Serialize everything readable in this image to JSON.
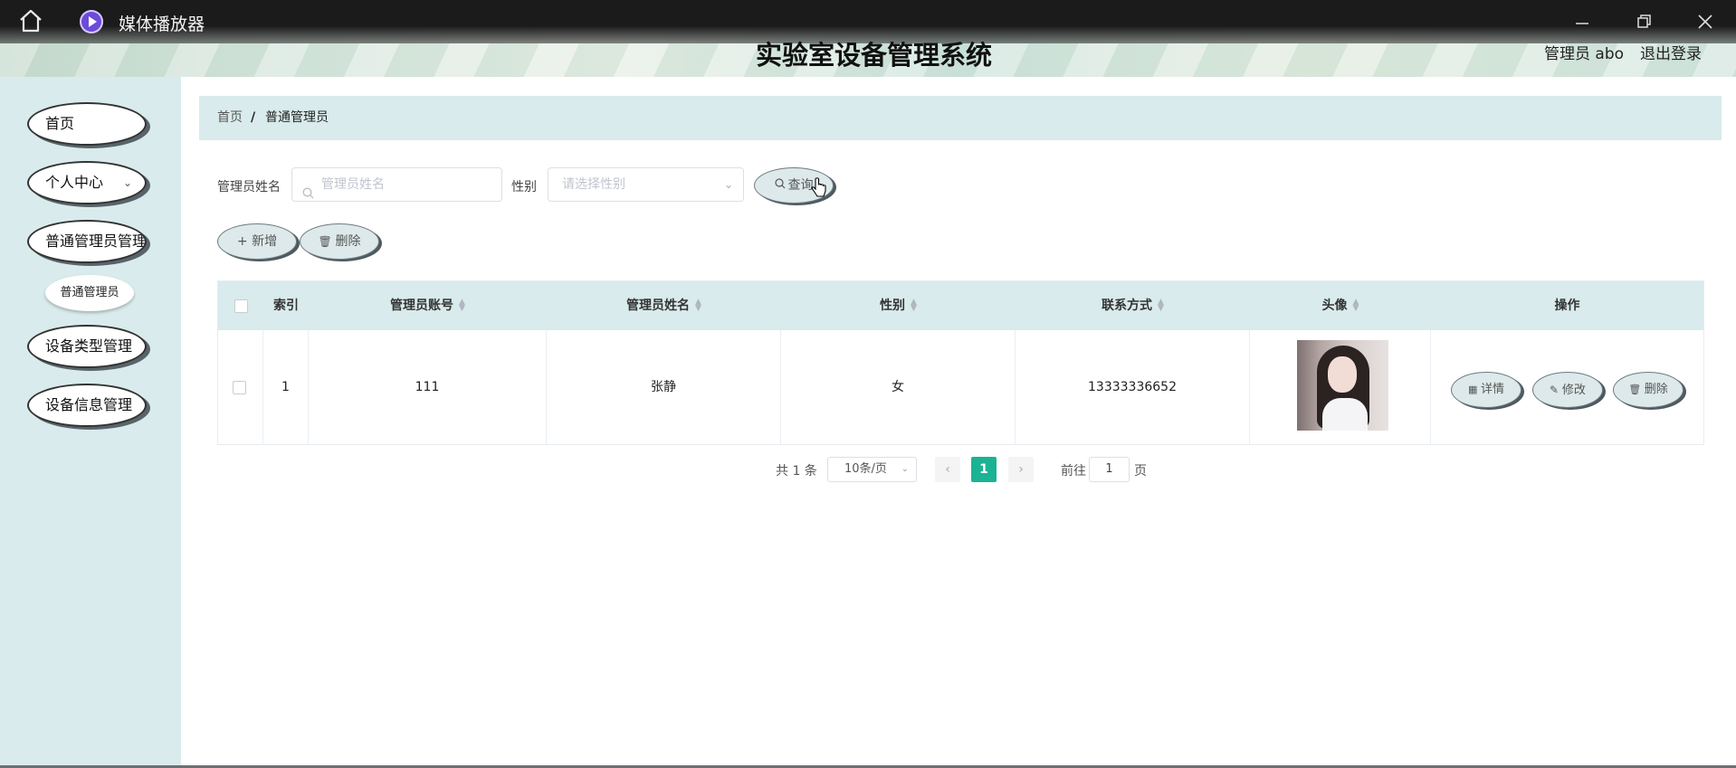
{
  "window": {
    "app_title": "媒体播放器"
  },
  "header": {
    "system_title": "实验室设备管理系统",
    "user_label": "管理员 abo",
    "logout_label": "退出登录"
  },
  "sidebar": {
    "items": [
      {
        "label": "首页"
      },
      {
        "label": "个人中心",
        "has_submenu": true
      },
      {
        "label": "普通管理员管理"
      },
      {
        "label": "设备类型管理"
      },
      {
        "label": "设备信息管理"
      }
    ],
    "sub_item": "普通管理员"
  },
  "breadcrumb": {
    "home": "首页",
    "separator": "/",
    "current": "普通管理员"
  },
  "search": {
    "name_label": "管理员姓名",
    "name_placeholder": "管理员姓名",
    "gender_label": "性别",
    "gender_placeholder": "请选择性别",
    "query_button": "查询"
  },
  "actions": {
    "add_button": "新增",
    "delete_button": "删除"
  },
  "table": {
    "headers": {
      "index": "索引",
      "account": "管理员账号",
      "name": "管理员姓名",
      "gender": "性别",
      "contact": "联系方式",
      "avatar": "头像",
      "operations": "操作"
    },
    "rows": [
      {
        "index": "1",
        "account": "111",
        "name": "张静",
        "gender": "女",
        "contact": "13333336652"
      }
    ],
    "row_actions": {
      "detail": "详情",
      "edit": "修改",
      "delete": "删除"
    }
  },
  "pagination": {
    "total": "共 1 条",
    "page_size": "10条/页",
    "current_page": "1",
    "goto_label": "前往",
    "goto_value": "1",
    "page_unit": "页"
  },
  "colors": {
    "accent": "#1ab394",
    "panel": "#d9ebec"
  }
}
